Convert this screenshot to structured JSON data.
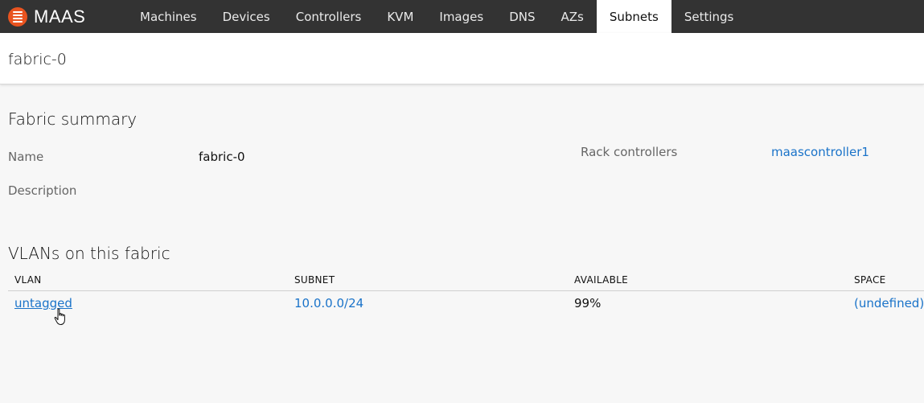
{
  "app": {
    "name": "MAAS",
    "accent_color": "#e95420",
    "logo_icon": "menu-icon"
  },
  "nav": {
    "items": [
      {
        "label": "Machines",
        "active": false
      },
      {
        "label": "Devices",
        "active": false
      },
      {
        "label": "Controllers",
        "active": false
      },
      {
        "label": "KVM",
        "active": false
      },
      {
        "label": "Images",
        "active": false
      },
      {
        "label": "DNS",
        "active": false
      },
      {
        "label": "AZs",
        "active": false
      },
      {
        "label": "Subnets",
        "active": true
      },
      {
        "label": "Settings",
        "active": false
      }
    ]
  },
  "page": {
    "title": "fabric-0"
  },
  "summary": {
    "title": "Fabric summary",
    "name_label": "Name",
    "name_value": "fabric-0",
    "description_label": "Description",
    "description_value": "",
    "rack_label": "Rack controllers",
    "rack_value": "maascontroller1"
  },
  "vlans": {
    "title": "VLANs on this fabric",
    "columns": {
      "vlan": "VLAN",
      "subnet": "SUBNET",
      "available": "AVAILABLE",
      "space": "SPACE"
    },
    "rows": [
      {
        "vlan": "untagged",
        "subnet": "10.0.0.0/24",
        "available": "99%",
        "space": "(undefined)"
      }
    ]
  },
  "colors": {
    "topbar": "#333333",
    "link": "#1a73c9"
  }
}
